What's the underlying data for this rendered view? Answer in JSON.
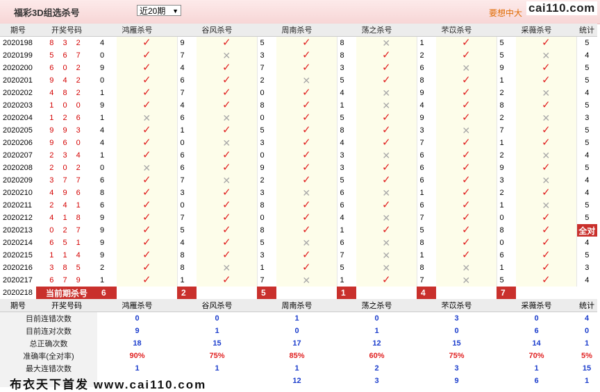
{
  "header": {
    "title": "福彩3D组选杀号",
    "period_select": "近20期",
    "promo": "要想中大",
    "logo": "cai110.com"
  },
  "columns": {
    "period": "期号",
    "numbers": "开奖号码",
    "experts": [
      "鸿雁杀号",
      "谷风杀号",
      "周南杀号",
      "荡之杀号",
      "芣苡杀号",
      "采薇杀号"
    ],
    "stats": "统计"
  },
  "rows": [
    {
      "p": "2020198",
      "n": "8 3 2",
      "k": [
        4,
        9,
        5,
        8,
        1,
        5
      ],
      "r": [
        1,
        1,
        1,
        0,
        1,
        1
      ],
      "t": "5"
    },
    {
      "p": "2020199",
      "n": "5 6 7",
      "k": [
        0,
        7,
        3,
        8,
        2,
        5
      ],
      "r": [
        1,
        0,
        1,
        1,
        1,
        0
      ],
      "t": "4"
    },
    {
      "p": "2020200",
      "n": "6 0 2",
      "k": [
        9,
        4,
        7,
        3,
        6,
        9
      ],
      "r": [
        1,
        1,
        1,
        1,
        0,
        1
      ],
      "t": "5"
    },
    {
      "p": "2020201",
      "n": "9 4 2",
      "k": [
        0,
        6,
        2,
        5,
        8,
        1
      ],
      "r": [
        1,
        1,
        0,
        1,
        1,
        1
      ],
      "t": "5"
    },
    {
      "p": "2020202",
      "n": "4 8 2",
      "k": [
        1,
        7,
        0,
        4,
        9,
        2
      ],
      "r": [
        1,
        1,
        1,
        0,
        1,
        0
      ],
      "t": "4"
    },
    {
      "p": "2020203",
      "n": "1 0 0",
      "k": [
        9,
        4,
        8,
        1,
        4,
        8
      ],
      "r": [
        1,
        1,
        1,
        0,
        1,
        1
      ],
      "t": "5"
    },
    {
      "p": "2020204",
      "n": "1 2 6",
      "k": [
        1,
        6,
        0,
        5,
        9,
        2
      ],
      "r": [
        0,
        0,
        1,
        1,
        1,
        0
      ],
      "t": "3"
    },
    {
      "p": "2020205",
      "n": "9 9 3",
      "k": [
        4,
        1,
        5,
        8,
        3,
        7
      ],
      "r": [
        1,
        1,
        1,
        1,
        0,
        1
      ],
      "t": "5"
    },
    {
      "p": "2020206",
      "n": "9 6 0",
      "k": [
        4,
        0,
        3,
        4,
        7,
        1
      ],
      "r": [
        1,
        0,
        1,
        1,
        1,
        1
      ],
      "t": "5"
    },
    {
      "p": "2020207",
      "n": "2 3 4",
      "k": [
        1,
        6,
        0,
        3,
        6,
        2
      ],
      "r": [
        1,
        1,
        1,
        0,
        1,
        0
      ],
      "t": "4"
    },
    {
      "p": "2020208",
      "n": "2 0 2",
      "k": [
        0,
        6,
        9,
        3,
        6,
        9
      ],
      "r": [
        0,
        1,
        1,
        1,
        1,
        1
      ],
      "t": "5"
    },
    {
      "p": "2020209",
      "n": "3 7 7",
      "k": [
        6,
        7,
        2,
        5,
        6,
        3
      ],
      "r": [
        1,
        0,
        1,
        1,
        1,
        0
      ],
      "t": "4"
    },
    {
      "p": "2020210",
      "n": "4 9 6",
      "k": [
        8,
        3,
        3,
        6,
        1,
        2
      ],
      "r": [
        1,
        1,
        0,
        0,
        1,
        1
      ],
      "t": "4"
    },
    {
      "p": "2020211",
      "n": "2 4 1",
      "k": [
        6,
        0,
        8,
        6,
        6,
        1
      ],
      "r": [
        1,
        1,
        1,
        1,
        1,
        0
      ],
      "t": "5"
    },
    {
      "p": "2020212",
      "n": "4 1 8",
      "k": [
        9,
        7,
        0,
        4,
        7,
        0
      ],
      "r": [
        1,
        1,
        1,
        0,
        1,
        1
      ],
      "t": "5"
    },
    {
      "p": "2020213",
      "n": "0 2 7",
      "k": [
        9,
        5,
        8,
        1,
        5,
        8
      ],
      "r": [
        1,
        1,
        1,
        1,
        1,
        1
      ],
      "t": "全对"
    },
    {
      "p": "2020214",
      "n": "6 5 1",
      "k": [
        9,
        4,
        5,
        6,
        8,
        0
      ],
      "r": [
        1,
        1,
        0,
        0,
        1,
        1
      ],
      "t": "4"
    },
    {
      "p": "2020215",
      "n": "1 1 4",
      "k": [
        9,
        8,
        3,
        7,
        1,
        6
      ],
      "r": [
        1,
        1,
        1,
        0,
        1,
        1
      ],
      "t": "5"
    },
    {
      "p": "2020216",
      "n": "3 8 5",
      "k": [
        2,
        8,
        1,
        5,
        8,
        1
      ],
      "r": [
        1,
        0,
        1,
        0,
        0,
        1
      ],
      "t": "3"
    },
    {
      "p": "2020217",
      "n": "6 7 9",
      "k": [
        1,
        1,
        7,
        1,
        7,
        5
      ],
      "r": [
        1,
        1,
        0,
        1,
        0,
        1
      ],
      "t": "4"
    }
  ],
  "current": {
    "p": "2020218",
    "label": "当前期杀号",
    "k": [
      "6",
      "2",
      "5",
      "1",
      "4",
      "7"
    ]
  },
  "stat_rows": [
    {
      "label": "目前连错次数",
      "v": [
        "0",
        "0",
        "1",
        "0",
        "3",
        "0"
      ],
      "t": "4"
    },
    {
      "label": "目前连对次数",
      "v": [
        "9",
        "1",
        "0",
        "1",
        "0",
        "6"
      ],
      "t": "0"
    },
    {
      "label": "总正确次数",
      "v": [
        "18",
        "15",
        "17",
        "12",
        "15",
        "14"
      ],
      "t": "1"
    },
    {
      "label": "准确率(全对率)",
      "v": [
        "90%",
        "75%",
        "85%",
        "60%",
        "75%",
        "70%"
      ],
      "t": "5%"
    },
    {
      "label": "最大连错次数",
      "v": [
        "1",
        "1",
        "1",
        "2",
        "3",
        "1"
      ],
      "t": "15"
    },
    {
      "label": "",
      "v": [
        "",
        "",
        "12",
        "3",
        "9",
        "6"
      ],
      "t": "1"
    }
  ],
  "marks": {
    "right": "✓",
    "wrong": "✕"
  },
  "footer": "布衣天下首发 www.cai110.com"
}
